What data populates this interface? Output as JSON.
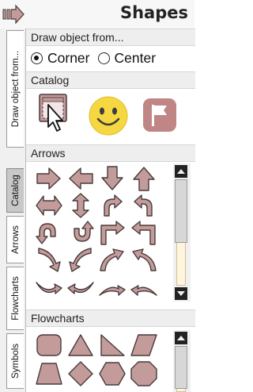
{
  "header": {
    "title": "Shapes",
    "icon": "arrow-right-icon"
  },
  "tabs": [
    {
      "label": "Draw object from...",
      "active": false
    },
    {
      "label": "Catalog",
      "active": true
    },
    {
      "label": "Arrows",
      "active": false
    },
    {
      "label": "Flowcharts",
      "active": false
    },
    {
      "label": "Symbols",
      "active": false
    }
  ],
  "draw_from": {
    "title": "Draw object from...",
    "options": [
      {
        "label": "Corner",
        "checked": true
      },
      {
        "label": "Center",
        "checked": false
      }
    ]
  },
  "catalog": {
    "title": "Catalog",
    "items": [
      "select-shape-icon",
      "smiley-icon",
      "flag-icon"
    ]
  },
  "arrows": {
    "title": "Arrows",
    "items": [
      "arrow-right",
      "arrow-left",
      "arrow-down",
      "arrow-up",
      "arrow-left-right",
      "arrow-up-down",
      "arrow-curved-right",
      "arrow-curved-left",
      "arrow-u-turn-down",
      "arrow-u-turn-up",
      "arrow-bent-right",
      "arrow-bent-left",
      "arrow-curved-down-left",
      "arrow-curved-down-right",
      "arrow-curved-up-right",
      "arrow-curved-up-left",
      "arrow-swoosh-1",
      "arrow-swoosh-2",
      "arrow-swoosh-3",
      "arrow-swoosh-4"
    ]
  },
  "flowcharts": {
    "title": "Flowcharts",
    "items": [
      "rounded-rectangle",
      "triangle",
      "right-triangle",
      "parallelogram",
      "trapezoid",
      "diamond",
      "hexagon",
      "octagon"
    ]
  },
  "colors": {
    "shape_fill": "#c39b9b",
    "shape_stroke": "#4a3a3a",
    "scroll_track": "#fff4dc"
  }
}
